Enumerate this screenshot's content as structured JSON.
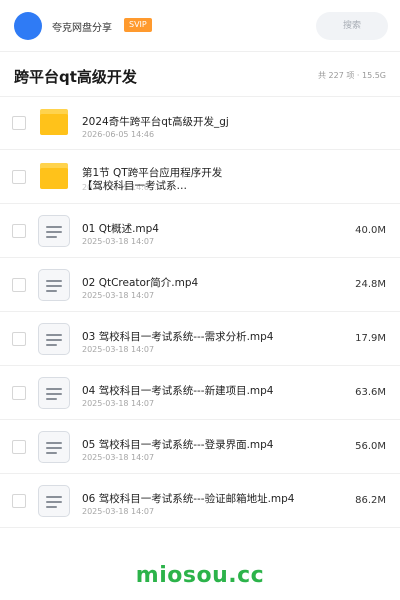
{
  "header": {
    "site_name": "夸克网盘分享",
    "badge": "SVIP",
    "search_label": "搜索",
    "avatar_color": "#2f7bf5"
  },
  "folder_title": "跨平台qt高级开发",
  "summary": "共 227 项 · 15.5G",
  "items": [
    {
      "type": "folder",
      "icon": "folder-icon",
      "name": "2024奇牛跨平台qt高级开发_gj",
      "date": "2026-06-05 14:46",
      "size": ""
    },
    {
      "type": "folder",
      "icon": "folder-icon",
      "name": "第1节 QT跨平台应用程序开发【驾校科目一考试系…",
      "date": "2026-06-05 14:0…",
      "size": ""
    },
    {
      "type": "file",
      "icon": "video-file-icon",
      "name": "01 Qt概述.mp4",
      "date": "2025-03-18 14:07",
      "size": "40.0M"
    },
    {
      "type": "file",
      "icon": "video-file-icon",
      "name": "02 QtCreator简介.mp4",
      "date": "2025-03-18 14:07",
      "size": "24.8M"
    },
    {
      "type": "file",
      "icon": "video-file-icon",
      "name": "03 驾校科目一考试系统---需求分析.mp4",
      "date": "2025-03-18 14:07",
      "size": "17.9M"
    },
    {
      "type": "file",
      "icon": "video-file-icon",
      "name": "04 驾校科目一考试系统---新建项目.mp4",
      "date": "2025-03-18 14:07",
      "size": "63.6M"
    },
    {
      "type": "file",
      "icon": "video-file-icon",
      "name": "05 驾校科目一考试系统---登录界面.mp4",
      "date": "2025-03-18 14:07",
      "size": "56.0M"
    },
    {
      "type": "file",
      "icon": "video-file-icon",
      "name": "06 驾校科目一考试系统---验证邮箱地址.mp4",
      "date": "2025-03-18 14:07",
      "size": "86.2M"
    }
  ],
  "watermark": "miosou.cc",
  "colors": {
    "accent": "#2f7bf5",
    "badge": "#ff9a2e",
    "folder": "#ffc21a",
    "watermark": "#2cb34a"
  }
}
